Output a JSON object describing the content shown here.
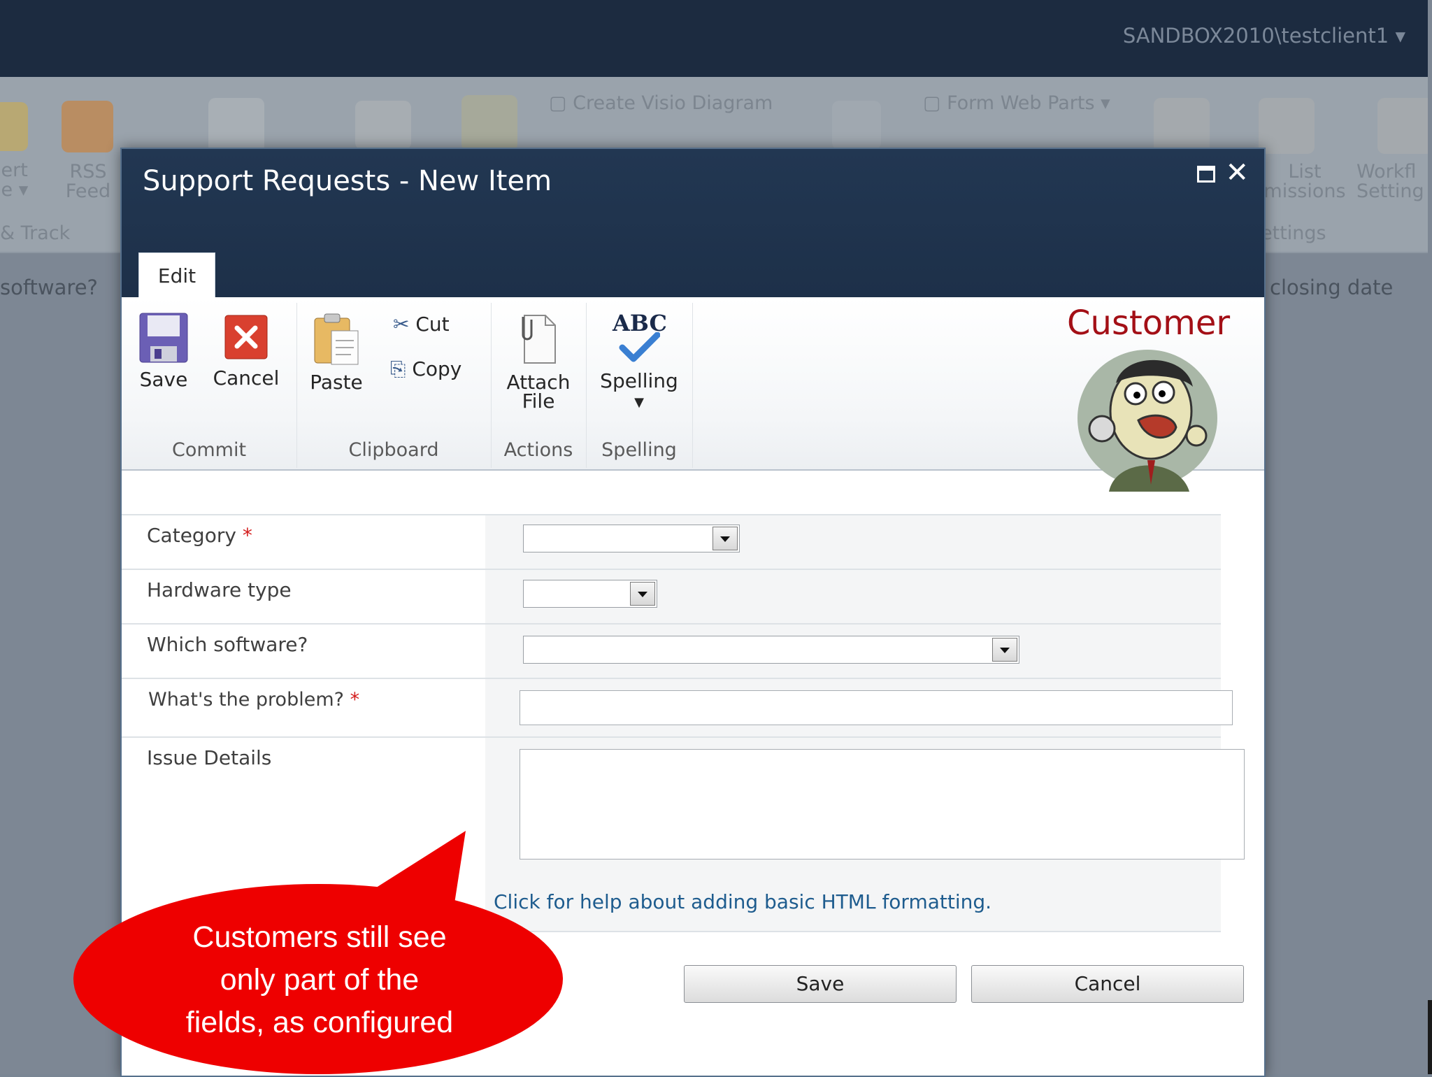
{
  "topbar": {
    "user": "SANDBOX2010\\testclient1"
  },
  "background_ribbon": {
    "alert_label": "lert\nde",
    "rss_label_1": "RSS",
    "rss_label_2": "Feed",
    "visio_label": "Create Visio Diagram",
    "webparts_label": "Form Web Parts",
    "list_label_1": "List",
    "list_label_2": "missions",
    "workflow_label_1": "Workfl",
    "workflow_label_2": "Setting",
    "group_track": "& Track",
    "group_settings": "ettings"
  },
  "background_columns": {
    "software": "software?",
    "closing": "closing date"
  },
  "dialog": {
    "title": "Support Requests - New Item",
    "tab": "Edit"
  },
  "ribbon": {
    "save": "Save",
    "cancel": "Cancel",
    "group_commit": "Commit",
    "paste": "Paste",
    "cut": "Cut",
    "copy": "Copy",
    "group_clipboard": "Clipboard",
    "attach_1": "Attach",
    "attach_2": "File",
    "group_actions": "Actions",
    "spelling": "Spelling",
    "group_spelling": "Spelling",
    "abc": "ABC"
  },
  "customer": {
    "label": "Customer"
  },
  "form": {
    "category_label": "Category",
    "hardware_label": "Hardware type",
    "software_label": "Which software?",
    "problem_label": "What's the problem?",
    "issue_label": "Issue Details",
    "required_mark": "*",
    "help_link": "Click for help about adding basic HTML formatting.",
    "save": "Save",
    "cancel": "Cancel"
  },
  "callout": {
    "line1": "Customers still see",
    "line2": "only part of the",
    "line3": "fields, as configured",
    "color": "#ee0000"
  }
}
